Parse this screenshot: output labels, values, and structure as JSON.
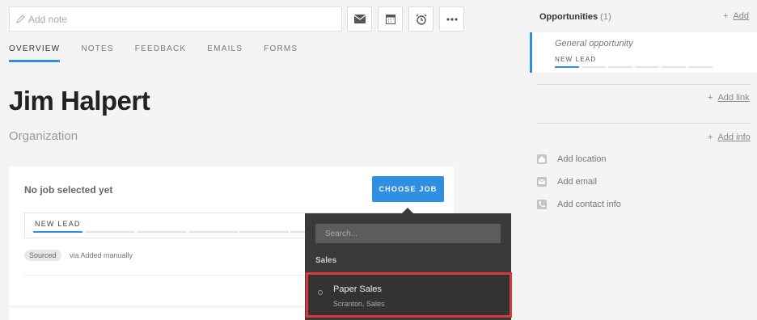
{
  "note": {
    "placeholder": "Add note"
  },
  "tabs": [
    "OVERVIEW",
    "NOTES",
    "FEEDBACK",
    "EMAILS",
    "FORMS"
  ],
  "candidate": {
    "name": "Jim Halpert",
    "organization": "Organization"
  },
  "job_card": {
    "empty_text": "No job selected yet",
    "choose_button": "CHOOSE JOB",
    "stage": "NEW LEAD",
    "source_badge": "Sourced",
    "source_via": "via Added manually"
  },
  "dropdown": {
    "search_placeholder": "Search...",
    "group": "Sales",
    "items": [
      {
        "title": "Paper Sales",
        "subtitle": "Scranton, Sales"
      }
    ]
  },
  "opportunities": {
    "title": "Opportunities",
    "count": "(1)",
    "add_label": "Add",
    "item_name": "General opportunity",
    "item_stage": "NEW LEAD"
  },
  "links": {
    "add_link": "Add link",
    "add_info": "Add info"
  },
  "contact": {
    "location": "Add location",
    "email": "Add email",
    "contact_info": "Add contact info"
  },
  "colors": {
    "accent": "#2f8fe3",
    "highlight": "#d73a3a",
    "dropdown_bg": "#3a3a3a"
  }
}
